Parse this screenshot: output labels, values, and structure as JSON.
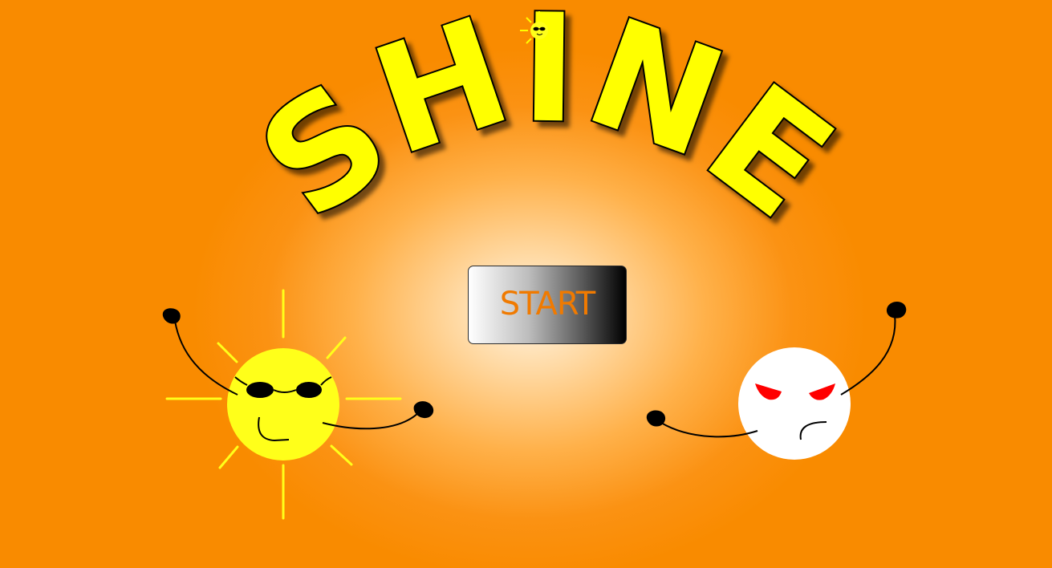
{
  "game": {
    "title": "SHINE",
    "start_label": "START"
  },
  "colors": {
    "background_orange": "#f98b00",
    "background_glow": "#fff4e2",
    "title_yellow": "#ffff00",
    "sun_yellow": "#ffff1a",
    "moon_white": "#ffffff",
    "angry_eye_red": "#ff0000",
    "start_text_orange": "#f07a00"
  },
  "characters": {
    "left": "sunglasses-sun-icon",
    "right": "angry-white-moon-icon",
    "top": "small-sun-icon"
  }
}
